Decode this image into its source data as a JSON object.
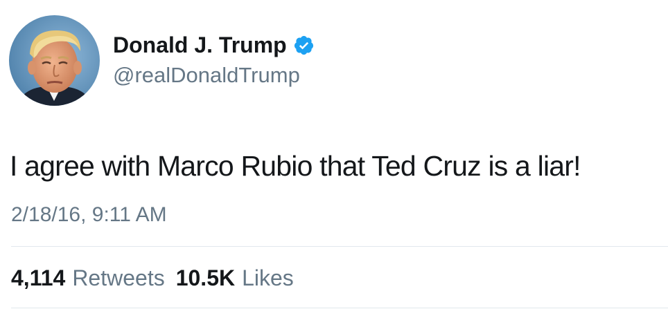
{
  "user": {
    "display_name": "Donald J. Trump",
    "handle": "@realDonaldTrump",
    "verified": true,
    "avatar_icon": "profile-photo",
    "verified_icon": "verified-badge-icon",
    "verified_color": "#1da1f2"
  },
  "tweet": {
    "text": "I agree with Marco Rubio that Ted Cruz is a liar!",
    "timestamp": "2/18/16, 9:11 AM"
  },
  "stats": {
    "retweets_count": "4,114",
    "retweets_label": "Retweets",
    "likes_count": "10.5K",
    "likes_label": "Likes"
  },
  "colors": {
    "text_primary": "#14171a",
    "text_secondary": "#657786",
    "divider": "#e1e8ed",
    "background": "#ffffff"
  }
}
